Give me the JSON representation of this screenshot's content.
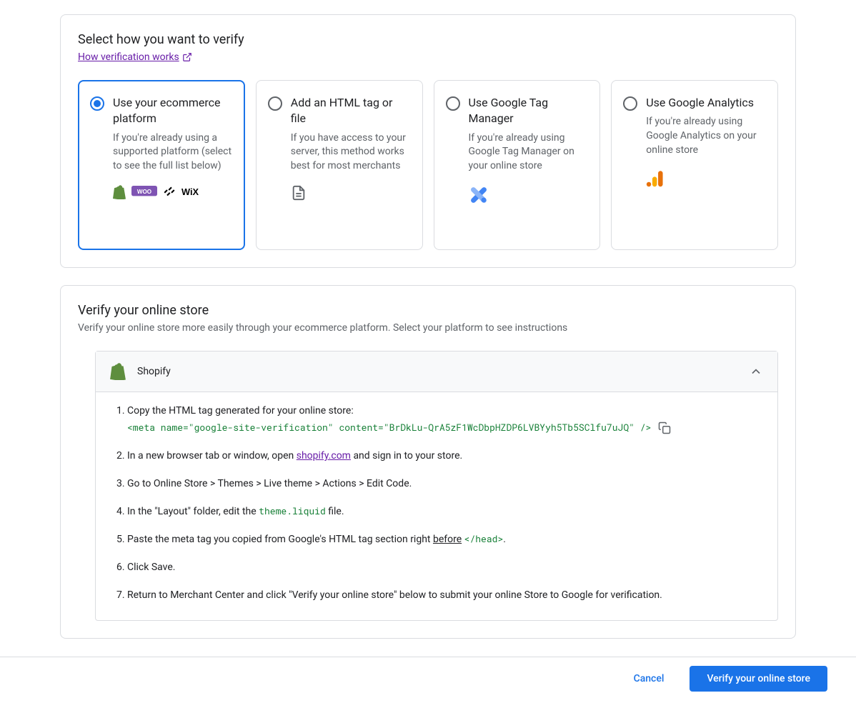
{
  "section1": {
    "title": "Select how you want to verify",
    "help_link": "How verification works",
    "options": [
      {
        "title": "Use your ecommerce platform",
        "desc": "If you're already using a supported platform (select to see the full list below)"
      },
      {
        "title": "Add an HTML tag or file",
        "desc": "If you have access to your server, this method works best for most merchants"
      },
      {
        "title": "Use Google Tag Manager",
        "desc": "If you're already using Google Tag Manager on your online store"
      },
      {
        "title": "Use Google Analytics",
        "desc": "If you're already using Google Analytics on your online store"
      }
    ]
  },
  "section2": {
    "title": "Verify your online store",
    "subtitle": "Verify your online store more easily through your ecommerce platform. Select your platform to see instructions",
    "accordion_title": "Shopify",
    "steps": {
      "s1": "Copy the HTML tag generated for your online store:",
      "code": "<meta name=\"google-site-verification\" content=\"BrDkLu-QrA5zF1WcDbpHZDP6LVBYyh5Tb5SClfu7uJQ\" />",
      "s2a": "In a new browser tab or window, open ",
      "s2link": "shopify.com",
      "s2b": " and sign in to your store.",
      "s3": "Go to Online Store > Themes > Live theme > Actions > Edit Code.",
      "s4a": "In the \"Layout\" folder, edit the ",
      "s4code": "theme.liquid",
      "s4b": " file.",
      "s5a": "Paste the meta tag you copied from Google's HTML tag section right ",
      "s5u": "before",
      "s5b": " ",
      "s5code": "</head>",
      "s5c": ".",
      "s6": "Click Save.",
      "s7": "Return to Merchant Center and click \"Verify your online store\" below to submit your online Store to Google for verification."
    }
  },
  "footer": {
    "cancel": "Cancel",
    "verify": "Verify your online store"
  }
}
